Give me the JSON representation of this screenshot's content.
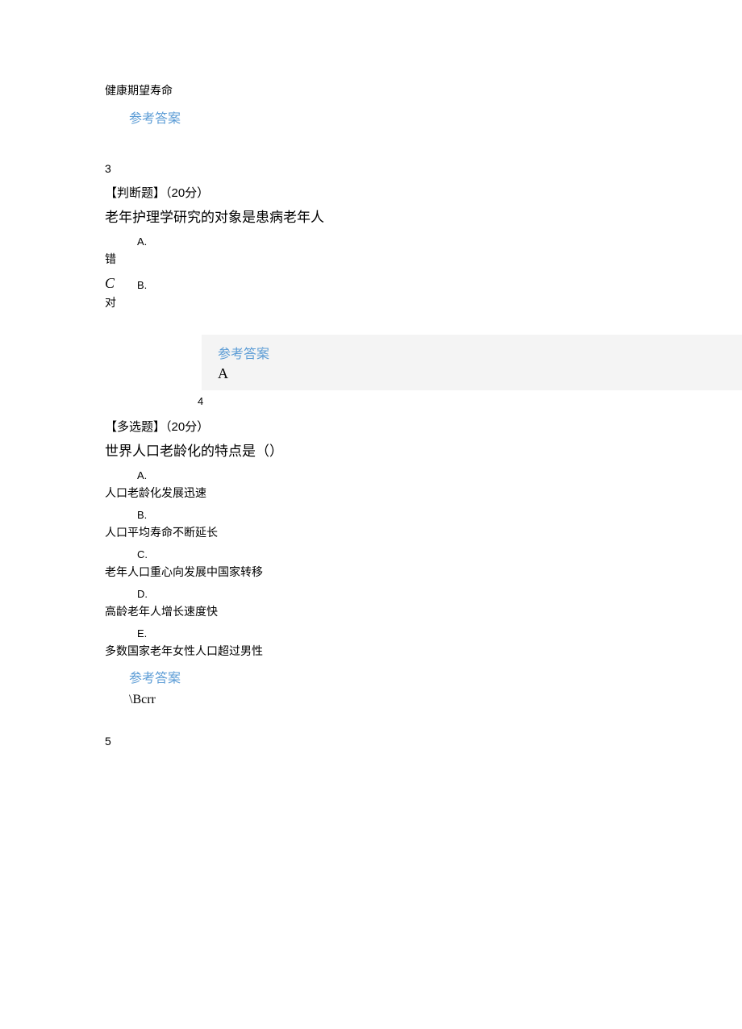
{
  "top_fragment": "健康期望寿命",
  "answer_label": "参考答案",
  "q3": {
    "num": "3",
    "type_line": "【判断题】（20分）",
    "text": "老年护理学研究的对象是患病老年人",
    "options": {
      "a_letter": "A.",
      "a_text": "错",
      "italic": "C",
      "b_letter": "B.",
      "b_text": "对"
    },
    "answer": "A"
  },
  "q4": {
    "num": "4",
    "type_line": "【多选题】（20分）",
    "text": "世界人口老龄化的特点是（）",
    "options": {
      "a_letter": "A.",
      "a_text": "人口老龄化发展迅速",
      "b_letter": "B.",
      "b_text": "人口平均寿命不断延长",
      "c_letter": "C.",
      "c_text": "老年人口重心向发展中国家转移",
      "d_letter": "D.",
      "d_text": "高龄老年人增长速度快",
      "e_letter": "E.",
      "e_text": "多数国家老年女性人口超过男性"
    },
    "answer": "\\Bcrr"
  },
  "q5": {
    "num": "5"
  }
}
